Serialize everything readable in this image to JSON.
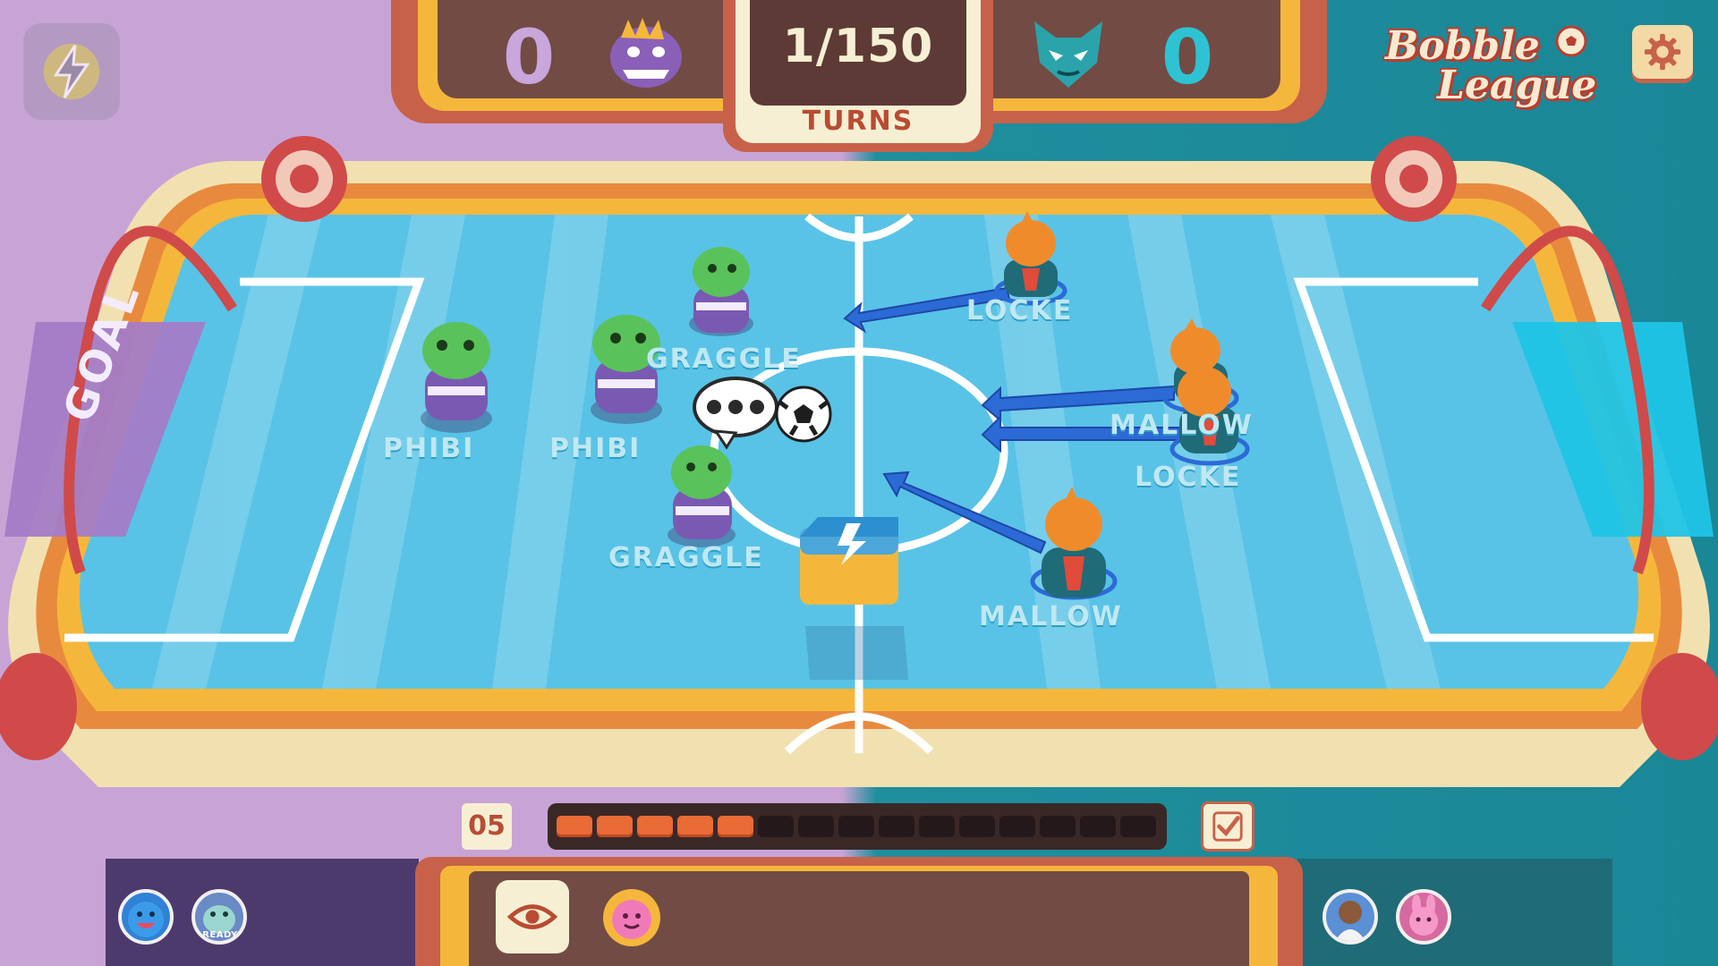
{
  "scoreboard": {
    "left_score": "0",
    "right_score": "0",
    "turn_count": "1/150",
    "turn_label": "TURNS",
    "left_crest": "purple-dinosaur-crest-icon",
    "right_crest": "teal-cat-crest-icon"
  },
  "brand": {
    "line1": "Bobble",
    "line2": "League"
  },
  "field": {
    "goal_label": "GOAL",
    "speech_bubble": "•••",
    "left_team_players": [
      "PHIBI",
      "PHIBI",
      "GRAGGLE",
      "GRAGGLE"
    ],
    "right_team_players": [
      "LOCKE",
      "MALLOW",
      "LOCKE",
      "MALLOW"
    ]
  },
  "action_bar": {
    "turn_number": "05",
    "timer_segments_total": 15,
    "timer_segments_filled": 5
  },
  "bottom": {
    "ready_label": "READY"
  },
  "colors": {
    "left_team": "#c8a4d6",
    "right_team": "#1f8e9d",
    "pitch": "#58c3e6",
    "accent_orange": "#f5b73b",
    "frame_red": "#c8614a",
    "arrow_blue": "#2c6ad6"
  },
  "icons": [
    "lightning-icon",
    "gear-icon",
    "eye-icon",
    "checkmark-icon",
    "emote-face-icon",
    "soccer-ball-icon",
    "powerup-box-icon"
  ]
}
